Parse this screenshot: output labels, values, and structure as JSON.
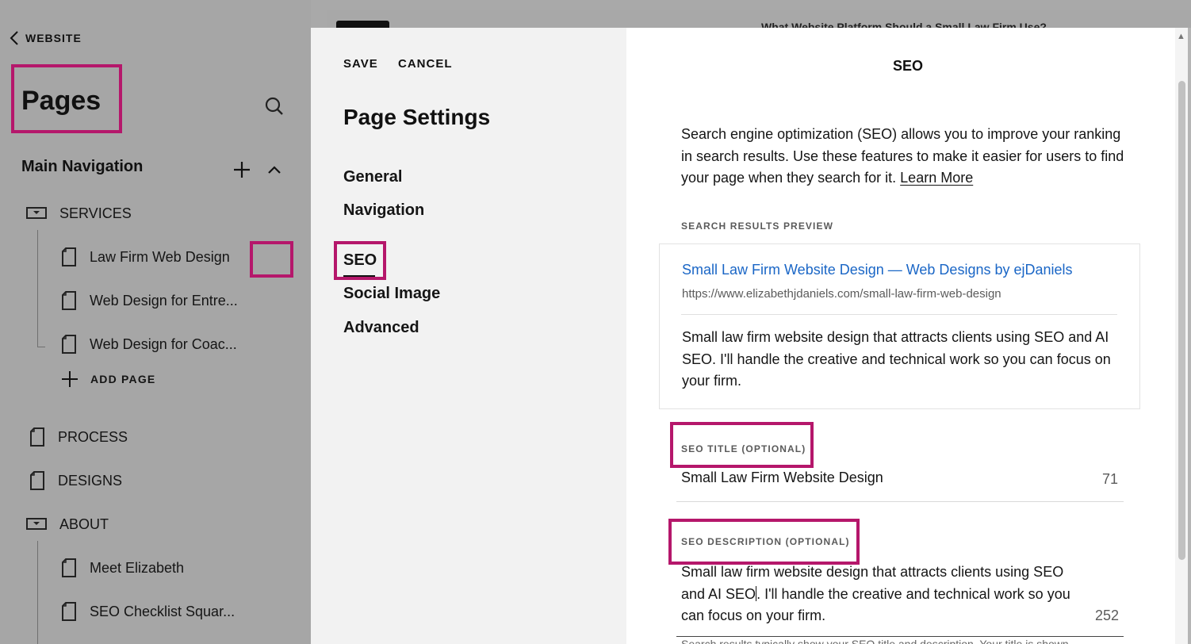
{
  "sidebar": {
    "back_label": "WEBSITE",
    "title": "Pages",
    "section_title": "Main Navigation",
    "add_page_label": "ADD PAGE",
    "items": [
      {
        "label": "SERVICES",
        "type": "folder"
      },
      {
        "label": "Law Firm Web Design",
        "type": "page"
      },
      {
        "label": "Web Design for Entre...",
        "type": "page"
      },
      {
        "label": "Web Design for Coac...",
        "type": "page"
      },
      {
        "label": "PROCESS",
        "type": "page"
      },
      {
        "label": "DESIGNS",
        "type": "page"
      },
      {
        "label": "ABOUT",
        "type": "folder"
      },
      {
        "label": "Meet Elizabeth",
        "type": "page"
      },
      {
        "label": "SEO Checklist Squar...",
        "type": "page"
      }
    ]
  },
  "background": {
    "article_title": "What Website Platform Should a Small Law Firm Use?"
  },
  "modal": {
    "save_label": "SAVE",
    "cancel_label": "CANCEL",
    "title": "Page Settings",
    "tabs": [
      "General",
      "Navigation",
      "SEO",
      "Social Image",
      "Advanced"
    ],
    "active_tab": "SEO"
  },
  "seo": {
    "heading": "SEO",
    "intro": "Search engine optimization (SEO) allows you to improve your ranking in search results. Use these features to make it easier for users to find your page when they search for it.",
    "learn_more": "Learn More",
    "preview_label": "SEARCH RESULTS PREVIEW",
    "preview": {
      "title": "Small Law Firm Website Design — Web Designs by ejDaniels",
      "url": "https://www.elizabethjdaniels.com/small-law-firm-web-design",
      "description": "Small law firm website design that attracts clients using SEO and AI SEO. I'll handle the creative and technical work so you can focus on your firm."
    },
    "title_field": {
      "label": "SEO TITLE (OPTIONAL)",
      "value": "Small Law Firm Website Design",
      "remaining": "71"
    },
    "description_field": {
      "label": "SEO DESCRIPTION (OPTIONAL)",
      "value_before_caret": "Small law firm website design that attracts clients using SEO and AI SEO",
      "value_after_caret": ". I'll handle the creative and technical work so you can focus on your firm.",
      "remaining": "252"
    },
    "helper_text": "Search results typically show your SEO title and description. Your title is shown"
  },
  "colors": {
    "highlight": "#b5176b",
    "link": "#1a66c6",
    "overlay": "#a6a6a6"
  }
}
